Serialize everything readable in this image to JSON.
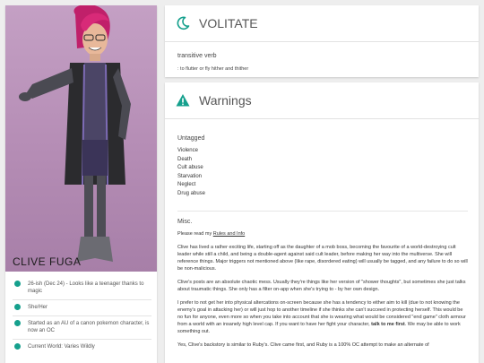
{
  "character": {
    "name": "CLIVE FUGA",
    "info": [
      "26-ish (Dec 24) - Looks like a teenager thanks to magic",
      "She/Her",
      "Started as an AU of a canon pokemon character, is now an OC",
      "Current World: Varies Wildly"
    ]
  },
  "word_panel": {
    "title": "VOLITATE",
    "icon": "moon-icon",
    "part_of_speech": "transitive verb",
    "definition": ": to flutter or fly hither and thither"
  },
  "warnings_panel": {
    "title": "Warnings",
    "icon": "warning-triangle-icon",
    "tagged_heading": "Untagged",
    "warnings": [
      "Violence",
      "Death",
      "Cult abuse",
      "Starvation",
      "Neglect",
      "Drug abuse"
    ],
    "misc_heading": "Misc.",
    "rules_prefix": "Please read my ",
    "rules_link": "Rules and Info",
    "paragraph_1": "Clive has lived a rather exciting life, starting off as the daughter of a mob boss, becoming the favourite of a world-destroying cult leader while still a child, and being a double-agent against said cult leader, before making her way into the multiverse. She will reference things. Major triggers not mentioned above (like rape, disordered eating) will usually be tagged, and any failure to do so will be non-malicious.",
    "paragraph_2": "Clive's posts are an absolute chaotic mess. Usually they're things like her version of \"shower thoughts\", but sometimes she just talks about traumatic things. She only has a filter on-app when she's trying to - by her own design.",
    "paragraph_3_a": "I prefer to not get her into physical altercations on-screen because she has a tendency to either aim to kill (due to not knowing the enemy's goal in attacking her) or will just hop to another timeline if she thinks she can't succeed in protecting herself. This would be no fun for anyone, even more so when you take into account that she is wearing what would be considered \"end game\" cloth armour from a world with an insanely high level cap. If you want to have her fight your character, ",
    "paragraph_3_bold": "talk to me first",
    "paragraph_3_b": ". We may be able to work something out.",
    "paragraph_4": "Yes, Clive's backstory is similar to Ruby's. Clive came first, and Ruby is a 100% OC attempt to make an alternate of"
  },
  "colors": {
    "accent": "#15a08d",
    "page_bg": "#eeeeee",
    "portrait_bg": "#b68eb6"
  }
}
